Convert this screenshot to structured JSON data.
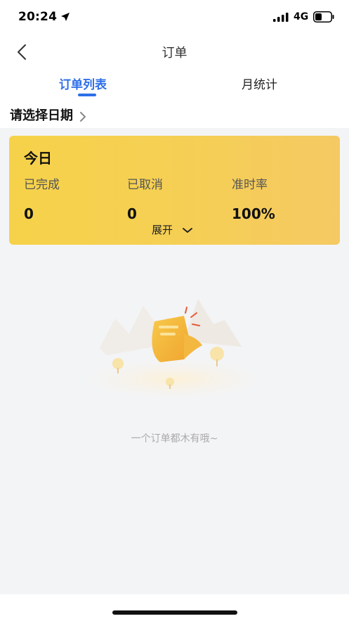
{
  "status_bar": {
    "time": "20:24",
    "network": "4G",
    "icons": [
      "location-arrow-icon",
      "signal-icon",
      "battery-icon"
    ]
  },
  "nav": {
    "title": "订单",
    "back_icon": "chevron-left-icon"
  },
  "tabs": [
    {
      "label": "订单列表",
      "active": true
    },
    {
      "label": "月统计",
      "active": false
    }
  ],
  "date_picker": {
    "label": "请选择日期",
    "icon": "chevron-right-icon"
  },
  "today_card": {
    "title": "今日",
    "stats": [
      {
        "label": "已完成",
        "value": "0"
      },
      {
        "label": "已取消",
        "value": "0"
      },
      {
        "label": "准时率",
        "value": "100%"
      }
    ],
    "expand_label": "展开",
    "expand_icon": "chevron-down-icon"
  },
  "empty_state": {
    "message": "一个订单都木有哦~",
    "illustration": "empty-orders-illustration"
  },
  "colors": {
    "accent": "#2f6fe8",
    "card_yellow": "#f6d24a",
    "background": "#f3f4f6"
  }
}
